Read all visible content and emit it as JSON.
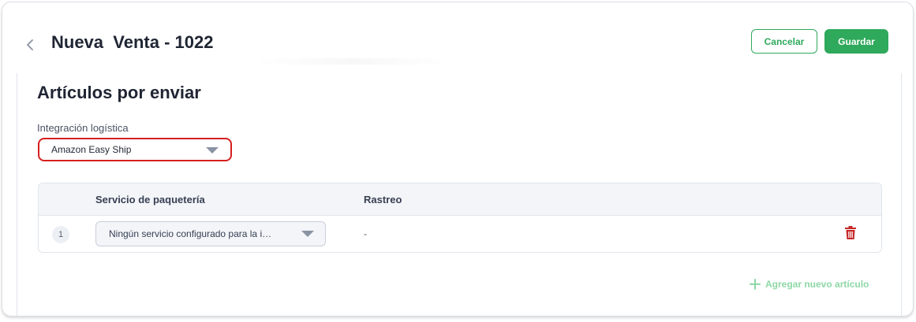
{
  "header": {
    "title": "Nueva  Venta - 1022",
    "cancel_label": "Cancelar",
    "save_label": "Guardar"
  },
  "section": {
    "title": "Artículos por enviar",
    "integration_label": "Integración logística",
    "integration_value": "Amazon Easy Ship"
  },
  "table": {
    "columns": [
      "Servicio de paquetería",
      "Rastreo"
    ],
    "rows": [
      {
        "number": "1",
        "service": "Ningún servicio configurado para la i…",
        "tracking": "-"
      }
    ]
  },
  "actions": {
    "add_item_label": "Agregar nuevo artículo"
  },
  "colors": {
    "primary_green": "#2fa95b",
    "highlight_red": "#d61f1f",
    "delete_red": "#c62828",
    "add_link_green": "#8dd8a6"
  }
}
